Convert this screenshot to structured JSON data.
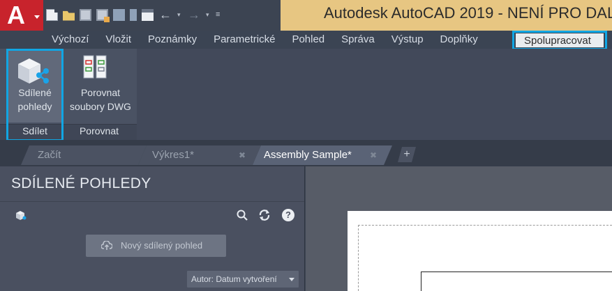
{
  "app": {
    "logo_letter": "A",
    "title": "Autodesk AutoCAD 2019 - NENÍ PRO DAL"
  },
  "quick_access": {
    "icons": [
      "new-icon",
      "open-icon",
      "save-icon",
      "save-as-icon",
      "open-web-icon",
      "save-web-icon",
      "plot-icon",
      "undo-icon",
      "redo-icon",
      "customize-menu-icon"
    ]
  },
  "ribbon_tabs": [
    "Výchozí",
    "Vložit",
    "Poznámky",
    "Parametrické",
    "Pohled",
    "Správa",
    "Výstup",
    "Doplňky"
  ],
  "active_tab": "Spolupracovat",
  "ribbon": {
    "share_button": {
      "line1": "Sdílené",
      "line2": "pohledy"
    },
    "compare_button": {
      "line1": "Porovnat",
      "line2": "soubory DWG"
    },
    "panels": {
      "share": "Sdílet",
      "compare": "Porovnat"
    }
  },
  "doc_tabs": {
    "start": "Začít",
    "drawing1": "Výkres1*",
    "assembly": "Assembly Sample*",
    "add": "+"
  },
  "palette": {
    "title": "SDÍLENÉ POHLEDY",
    "help_label": "?",
    "new_view_button": "Nový sdílený pohled",
    "sort_button": "Autor: Datum vytvoření"
  },
  "colors": {
    "highlight": "#11a6e4",
    "title_bar": "#e7c682",
    "logo": "#c8232c"
  }
}
